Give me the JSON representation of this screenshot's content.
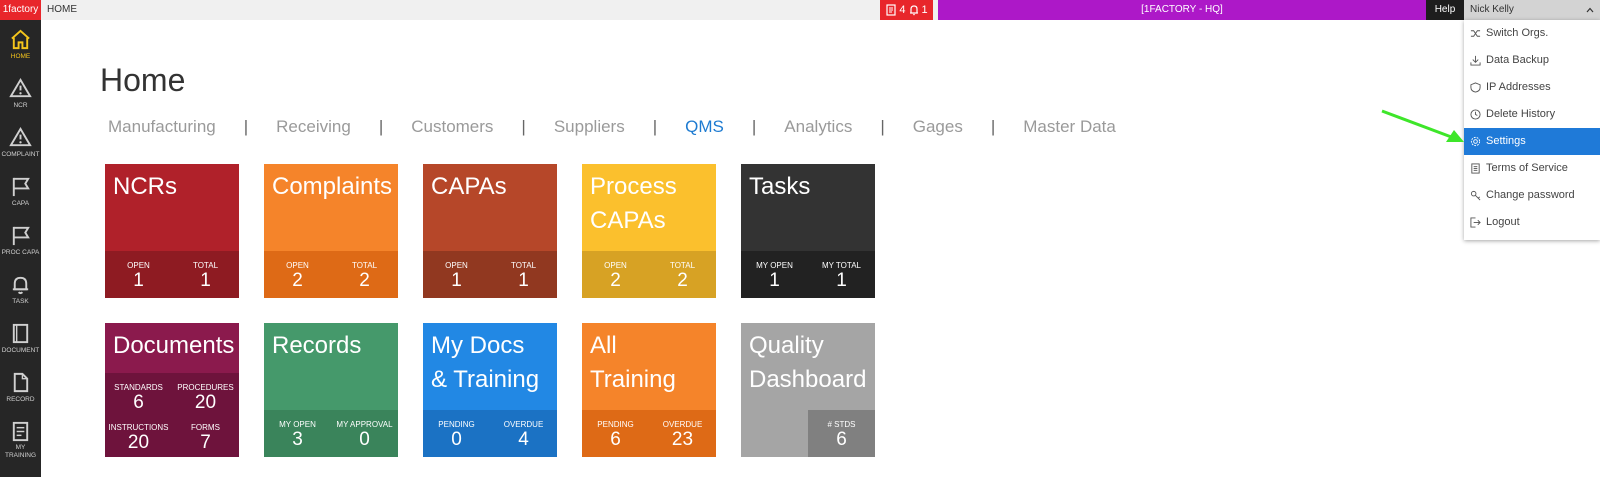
{
  "topbar": {
    "logo": "1factory",
    "breadcrumb": "HOME",
    "alerts_count_a": "4",
    "alerts_count_b": "1",
    "org": "[1FACTORY - HQ]",
    "help": "Help",
    "user": "Nick Kelly"
  },
  "sidebar": {
    "items": [
      {
        "label": "HOME",
        "icon": "home-icon"
      },
      {
        "label": "NCR",
        "icon": "warning-icon"
      },
      {
        "label": "COMPLAINT",
        "icon": "warning-icon"
      },
      {
        "label": "CAPA",
        "icon": "flag-icon"
      },
      {
        "label": "PROC CAPA",
        "icon": "flag-icon"
      },
      {
        "label": "TASK",
        "icon": "bell-icon"
      },
      {
        "label": "DOCUMENT",
        "icon": "book-icon"
      },
      {
        "label": "RECORD",
        "icon": "file-icon"
      },
      {
        "label": "MY",
        "label2": "TRAINING",
        "icon": "training-icon"
      }
    ]
  },
  "page": {
    "title": "Home"
  },
  "tabs": [
    "Manufacturing",
    "Receiving",
    "Customers",
    "Suppliers",
    "QMS",
    "Analytics",
    "Gages",
    "Master Data"
  ],
  "active_tab": "QMS",
  "tiles": [
    {
      "title1": "NCRs",
      "title2": "",
      "color": "#b0212a",
      "foot_color": "#8e1b22",
      "s1k": "OPEN",
      "s1v": "1",
      "s2k": "TOTAL",
      "s2v": "1"
    },
    {
      "title1": "Complaints",
      "title2": "",
      "color": "#f5842a",
      "foot_color": "#de6a16",
      "s1k": "OPEN",
      "s1v": "2",
      "s2k": "TOTAL",
      "s2v": "2"
    },
    {
      "title1": "CAPAs",
      "title2": "",
      "color": "#b64729",
      "foot_color": "#913820",
      "s1k": "OPEN",
      "s1v": "1",
      "s2k": "TOTAL",
      "s2v": "1"
    },
    {
      "title1": "Process",
      "title2": "CAPAs",
      "color": "#fbc02d",
      "foot_color": "#d7a224",
      "s1k": "OPEN",
      "s1v": "2",
      "s2k": "TOTAL",
      "s2v": "2"
    },
    {
      "title1": "Tasks",
      "title2": "",
      "color": "#333333",
      "foot_color": "#222222",
      "s1k": "MY OPEN",
      "s1v": "1",
      "s2k": "MY TOTAL",
      "s2v": "1"
    },
    {
      "title1": "Documents",
      "title2": "",
      "color": "#8b1a4d",
      "foot_color": "#6e133c",
      "s1k": "STANDARDS",
      "s1v": "6",
      "s2k": "PROCEDURES",
      "s2v": "20",
      "s3k": "INSTRUCTIONS",
      "s3v": "20",
      "s4k": "FORMS",
      "s4v": "7"
    },
    {
      "title1": "Records",
      "title2": "",
      "color": "#45996b",
      "foot_color": "#3a845b",
      "s1k": "MY OPEN",
      "s1v": "3",
      "s2k": "MY APPROVAL",
      "s2v": "0"
    },
    {
      "title1": "My Docs",
      "title2": "& Training",
      "color": "#2288e4",
      "foot_color": "#1b72c4",
      "s1k": "PENDING",
      "s1v": "0",
      "s2k": "OVERDUE",
      "s2v": "4"
    },
    {
      "title1": "All",
      "title2": "Training",
      "color": "#f5842a",
      "foot_color": "#de6a16",
      "s1k": "PENDING",
      "s1v": "6",
      "s2k": "OVERDUE",
      "s2v": "23"
    },
    {
      "title1": "Quality",
      "title2": "Dashboard",
      "color": "#a5a5a5",
      "foot_color": "#808080",
      "s2k": "# STDS",
      "s2v": "6"
    }
  ],
  "user_menu": {
    "items": [
      "Switch Orgs.",
      "Data Backup",
      "IP Addresses",
      "Delete History",
      "Settings",
      "Terms of Service",
      "Change password",
      "Logout"
    ],
    "active": "Settings"
  },
  "colors": {
    "sidebar_bg": "#262626",
    "active_nav": "#f5c51c",
    "brand_red": "#e8262b",
    "org_purple": "#ad18c8",
    "active_tab": "#1e7bd1",
    "menu_active": "#1f7ad8",
    "annotation_arrow": "#3ee62a"
  }
}
